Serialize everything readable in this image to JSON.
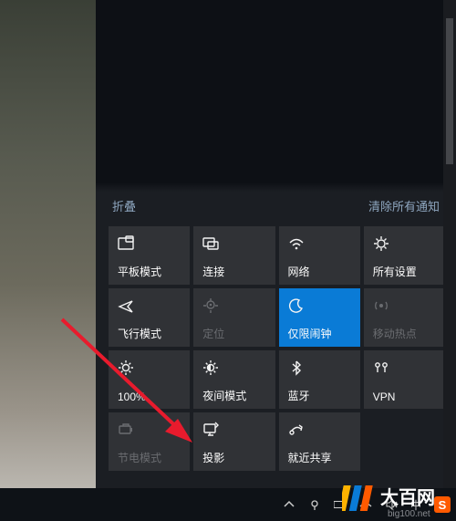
{
  "header": {
    "collapse_label": "折叠",
    "clear_label": "清除所有通知"
  },
  "tiles": [
    {
      "id": "tablet-mode",
      "label": "平板模式",
      "icon": "tablet-icon",
      "state": "normal"
    },
    {
      "id": "connect",
      "label": "连接",
      "icon": "connect-icon",
      "state": "normal"
    },
    {
      "id": "network",
      "label": "网络",
      "icon": "wifi-icon",
      "state": "normal"
    },
    {
      "id": "all-settings",
      "label": "所有设置",
      "icon": "gear-icon",
      "state": "normal"
    },
    {
      "id": "airplane-mode",
      "label": "飞行模式",
      "icon": "airplane-icon",
      "state": "normal"
    },
    {
      "id": "location",
      "label": "定位",
      "icon": "location-icon",
      "state": "disabled"
    },
    {
      "id": "alarms-only",
      "label": "仅限闹钟",
      "icon": "moon-icon",
      "state": "active"
    },
    {
      "id": "mobile-hotspot",
      "label": "移动热点",
      "icon": "hotspot-icon",
      "state": "disabled"
    },
    {
      "id": "brightness-100",
      "label": "100%",
      "icon": "brightness-icon",
      "state": "normal"
    },
    {
      "id": "night-light",
      "label": "夜间模式",
      "icon": "nightlight-icon",
      "state": "normal"
    },
    {
      "id": "bluetooth",
      "label": "蓝牙",
      "icon": "bluetooth-icon",
      "state": "normal"
    },
    {
      "id": "vpn",
      "label": "VPN",
      "icon": "vpn-icon",
      "state": "normal"
    },
    {
      "id": "battery-saver",
      "label": "节电模式",
      "icon": "battery-icon",
      "state": "disabled"
    },
    {
      "id": "project",
      "label": "投影",
      "icon": "project-icon",
      "state": "normal"
    },
    {
      "id": "nearby-sharing",
      "label": "就近共享",
      "icon": "share-icon",
      "state": "normal"
    }
  ],
  "tray": {
    "ime_text": "中"
  },
  "watermark": {
    "brand_text": "大百网",
    "domain_text": "big100.net"
  },
  "annotation": {
    "arrow_color": "#e81b2d"
  }
}
